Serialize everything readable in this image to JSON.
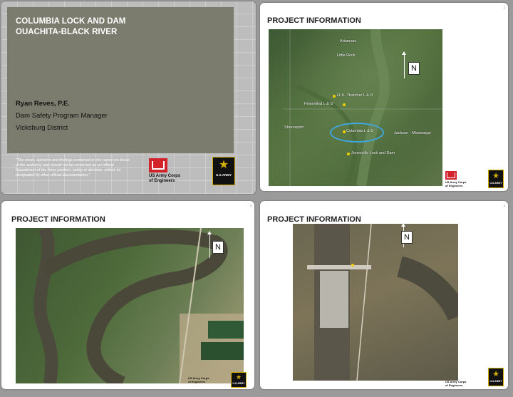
{
  "slide1": {
    "title_line1": "COLUMBIA LOCK AND DAM",
    "title_line2": "OUACHITA-BLACK RIVER",
    "presenter_name": "Ryan Reves, P.E.",
    "presenter_role": "Dam Safety Program Manager",
    "presenter_district": "Vicksburg District",
    "disclaimer": "\"The views, opinions and findings contained in this report are those of the author(s) and should not be construed as an official Department of the Army position, policy or decision, unless so designated by other official documentation.\"",
    "usace_line1": "US Army Corps",
    "usace_line2": "of Engineers",
    "army_label": "U.S.ARMY"
  },
  "slide2": {
    "title": "PROJECT INFORMATION",
    "north": "N",
    "places": {
      "monroe_label": "H. K. Thatcher L & D",
      "felsenthal": "Felsenthal L & D",
      "shreveport": "Shreveport",
      "columbia": "Columbia L & D",
      "jackson": "Jackson · Mississippi",
      "jonesville": "Jonesville Lock and Dam",
      "little_rock": "Little Rock",
      "arkansas": "Arkansas"
    },
    "usace_line1": "US Army Corps",
    "usace_line2": "of Engineers",
    "army_label": "U.S.ARMY"
  },
  "slide3": {
    "title": "PROJECT INFORMATION",
    "north": "N",
    "usace_line1": "US Army Corps",
    "usace_line2": "of Engineers",
    "army_label": "U.S.ARMY"
  },
  "slide4": {
    "title": "PROJECT INFORMATION",
    "north": "N",
    "usace_line1": "US Army Corps",
    "usace_line2": "of Engineers",
    "army_label": "U.S.ARMY"
  }
}
